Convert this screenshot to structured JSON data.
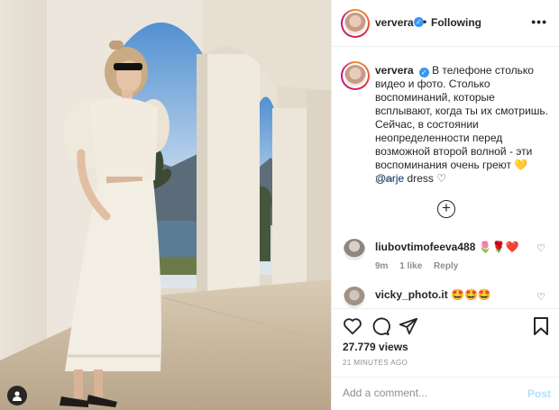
{
  "post": {
    "username": "ververa",
    "verified_mark": "✓",
    "header_separator": "•",
    "follow_status": "Following",
    "more_icon": "more-options-icon"
  },
  "caption": {
    "username": "ververa",
    "text": "В телефоне столько видео и фото. Столько воспоминаний, которые всплывают, когда ты их смотришь. Сейчас, в состоянии неопределенности перед возможной второй волной - эти воспоминания очень греют",
    "emoji": "💛",
    "mention": "@arje",
    "after_mention": " dress ",
    "outline_heart": "♡",
    "time": "21m"
  },
  "load_more": "+",
  "comments": [
    {
      "username": "liubovtimofeeva488",
      "text": "🌷🌹❤️",
      "time": "9m",
      "likes": "1 like",
      "reply": "Reply"
    },
    {
      "username": "vicky_photo.it",
      "text": "🤩🤩🤩"
    }
  ],
  "stats": {
    "views": "27.779 views",
    "posted_ago": "21 MINUTES AGO"
  },
  "comment_input": {
    "placeholder": "Add a comment...",
    "post_label": "Post"
  },
  "colors": {
    "verified": "#3897f0",
    "post_button_disabled": "#b2dffc",
    "mention": "#00376b"
  }
}
